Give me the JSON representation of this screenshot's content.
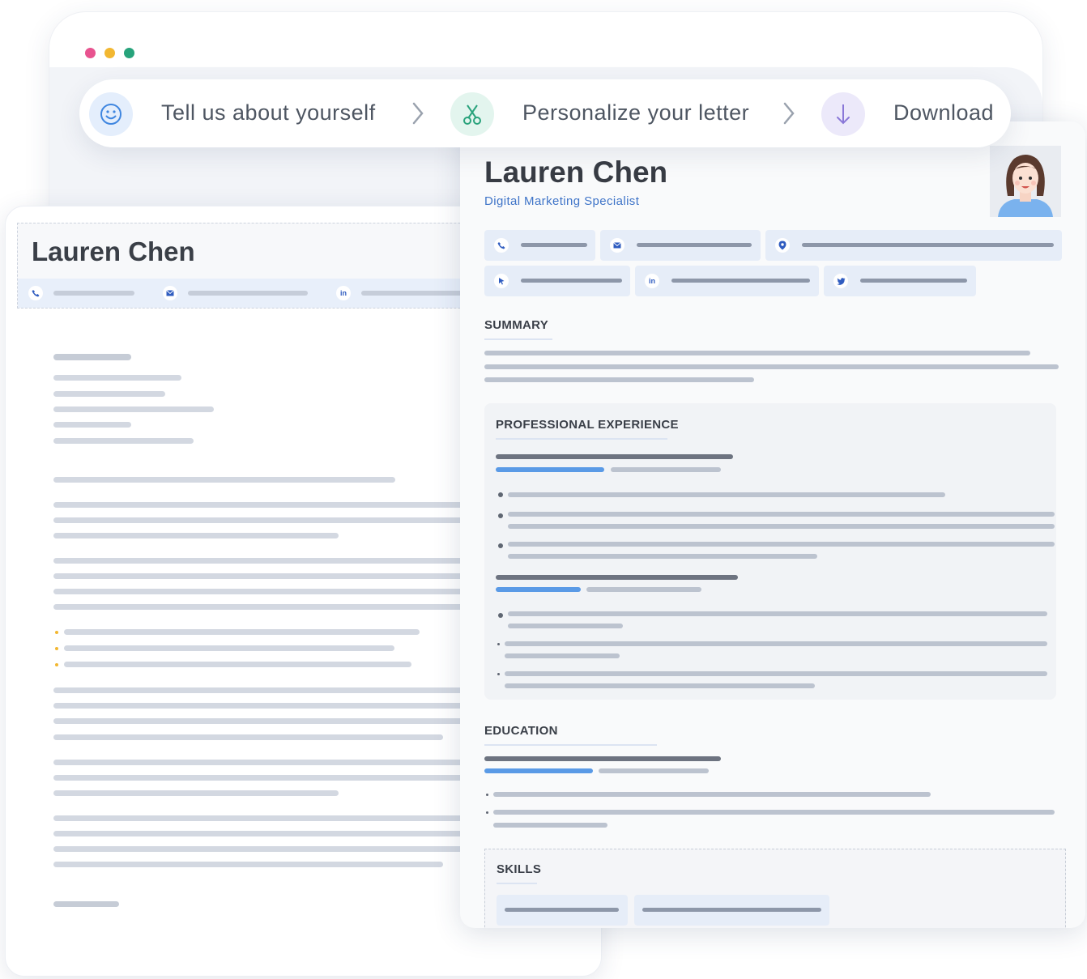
{
  "browser": {
    "dots": [
      "#e8538f",
      "#f2b731",
      "#27a37b"
    ]
  },
  "steps": [
    {
      "label": "Tell us about yourself",
      "icon": "smiley-icon",
      "color": "#e4eefc"
    },
    {
      "label": "Personalize your letter",
      "icon": "scissors-icon",
      "color": "#e3f5ee"
    },
    {
      "label": "Download",
      "icon": "download-arrow-icon",
      "color": "#ece9fa"
    }
  ],
  "letter": {
    "name": "Lauren Chen",
    "contact_icons": [
      "phone-icon",
      "email-icon",
      "linkedin-icon"
    ],
    "linkedin_text": "in"
  },
  "resume": {
    "name": "Lauren Chen",
    "title": "Digital Marketing Specialist",
    "contact_icons": [
      "phone-icon",
      "email-icon",
      "location-icon",
      "cursor-icon",
      "linkedin-icon",
      "twitter-icon"
    ],
    "linkedin_text": "in",
    "sections": {
      "summary": "SUMMARY",
      "experience": "PROFESSIONAL EXPERIENCE",
      "education": "EDUCATION",
      "skills": "SKILLS"
    }
  },
  "colors": {
    "accent_blue": "#3f74c8",
    "bar_blue": "#5a9ae6",
    "bullet_yellow": "#f2b731"
  }
}
